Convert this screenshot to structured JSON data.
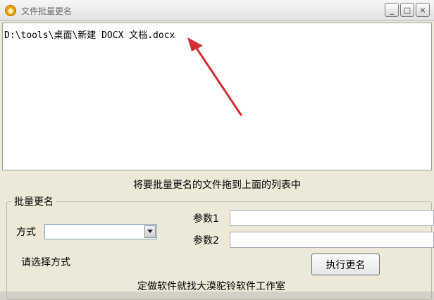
{
  "window": {
    "title": "文件批量更名",
    "controls": {
      "minimize": "_",
      "maximize": "□",
      "close": "×"
    }
  },
  "file_list": {
    "items": [
      "D:\\tools\\桌面\\新建 DOCX 文档.docx"
    ]
  },
  "annotation": {
    "color": "#d03030"
  },
  "panel": {
    "hint": "将要批量更名的文件拖到上面的列表中",
    "group_title": "批量更名",
    "mode_label": "方式",
    "mode_value": "",
    "param1_label": "参数1",
    "param1_value": "",
    "param2_label": "参数2",
    "param2_value": "",
    "status": "请选择方式",
    "execute_button": "执行更名",
    "footer": "定做软件就找大漠驼铃软件工作室"
  }
}
